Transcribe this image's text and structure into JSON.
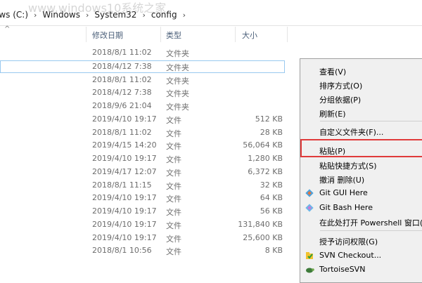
{
  "address": {
    "crumbs": [
      "ows (C:)",
      "Windows",
      "System32",
      "config"
    ],
    "separator": "›",
    "watermark": "www.windows10系统之家"
  },
  "columns": {
    "sort_glyph": "^",
    "modified": "修改日期",
    "type": "类型",
    "size": "大小"
  },
  "files": [
    {
      "date": "2018/8/1 11:02",
      "type": "文件夹",
      "size": ""
    },
    {
      "date": "2018/4/12 7:38",
      "type": "文件夹",
      "size": ""
    },
    {
      "date": "2018/8/1 11:02",
      "type": "文件夹",
      "size": ""
    },
    {
      "date": "2018/4/12 7:38",
      "type": "文件夹",
      "size": ""
    },
    {
      "date": "2018/9/6 21:04",
      "type": "文件夹",
      "size": ""
    },
    {
      "date": "2019/4/10 19:17",
      "type": "文件",
      "size": "512 KB"
    },
    {
      "date": "2018/8/1 11:02",
      "type": "文件",
      "size": "28 KB"
    },
    {
      "date": "2019/4/15 14:20",
      "type": "文件",
      "size": "56,064 KB"
    },
    {
      "date": "2019/4/10 19:17",
      "type": "文件",
      "size": "1,280 KB"
    },
    {
      "date": "2019/4/17 12:07",
      "type": "文件",
      "size": "6,372 KB"
    },
    {
      "date": "2018/8/1 11:15",
      "type": "文件",
      "size": "32 KB"
    },
    {
      "date": "2019/4/10 19:17",
      "type": "文件",
      "size": "64 KB"
    },
    {
      "date": "2019/4/10 19:17",
      "type": "文件",
      "size": "56 KB"
    },
    {
      "date": "2019/4/10 19:17",
      "type": "文件",
      "size": "131,840 KB"
    },
    {
      "date": "2019/4/10 19:17",
      "type": "文件",
      "size": "25,600 KB"
    },
    {
      "date": "2018/8/1 10:56",
      "type": "文件",
      "size": "8 KB"
    }
  ],
  "menu": {
    "view": "查看(V)",
    "sort": "排序方式(O)",
    "group": "分组依据(P)",
    "refresh": "刷新(E)",
    "customize": "自定义文件夹(F)...",
    "paste": "粘贴(P)",
    "paste_shortcut": "粘贴快捷方式(S)",
    "undo_delete": "撤消 删除(U)",
    "git_gui": "Git GUI Here",
    "git_bash": "Git Bash Here",
    "powershell": "在此处打开 Powershell 窗口(S",
    "give_access": "授予访问权限(G)",
    "svn_checkout": "SVN Checkout...",
    "tortoise": "TortoiseSVN"
  },
  "colors": {
    "highlight_border": "#e03b3b",
    "selection_border": "#99c9ef",
    "menu_bg": "#f0f0f0"
  }
}
